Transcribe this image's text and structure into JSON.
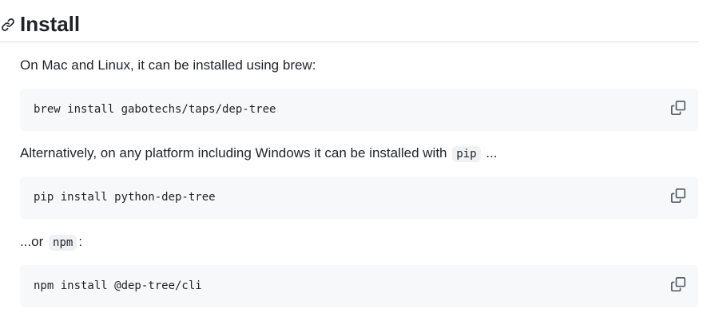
{
  "section": {
    "title": "Install",
    "anchor_icon": "link-icon"
  },
  "intro": {
    "text": "On Mac and Linux, it can be installed using brew:"
  },
  "brew": {
    "command": "brew install gabotechs/taps/dep-tree",
    "copy_icon": "copy-icon"
  },
  "alt": {
    "text_before": "Alternatively, on any platform including Windows it can be installed with",
    "code": "pip",
    "text_after": "..."
  },
  "pip": {
    "command": "pip install python-dep-tree",
    "copy_icon": "copy-icon"
  },
  "or_line": {
    "text_before": "...or",
    "code": "npm",
    "text_after": ":"
  },
  "npm": {
    "command": "npm install @dep-tree/cli",
    "copy_icon": "copy-icon"
  },
  "colors": {
    "text": "#1f2328",
    "code_block_bg": "#f6f8fa",
    "inline_code_bg": "#eff1f3",
    "divider": "#d8dee4",
    "icon": "#59636e"
  }
}
